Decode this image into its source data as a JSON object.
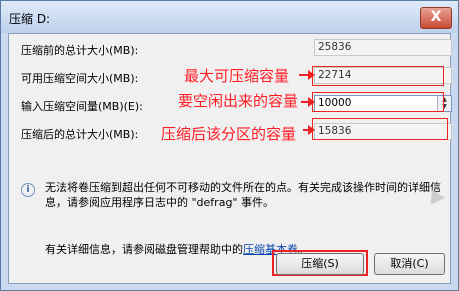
{
  "window": {
    "title": "压缩 D:",
    "close_symbol": "X"
  },
  "fields": [
    {
      "label": "压缩前的总计大小(MB):",
      "value": "25836"
    },
    {
      "label": "可用压缩空间大小(MB):",
      "value": "22714"
    },
    {
      "label": "输入压缩空间量(MB)(E):",
      "value": "10000"
    },
    {
      "label": "压缩后的总计大小(MB):",
      "value": "15836"
    }
  ],
  "annotations": [
    "最大可压缩容量",
    "要空闲出来的容量",
    "压缩后该分区的容量"
  ],
  "annotation_color": "#ff1d25",
  "info_text": "无法将卷压缩到超出任何不可移动的文件所在的点。有关完成该操作时间的详细信息，请参阅应用程序日志中的 \"defrag\" 事件。",
  "help": {
    "prefix": "有关详细信息，请参阅磁盘管理帮助中的",
    "link": "压缩基本卷",
    "suffix": "。"
  },
  "buttons": {
    "shrink": "压缩(S)",
    "cancel": "取消(C)"
  }
}
